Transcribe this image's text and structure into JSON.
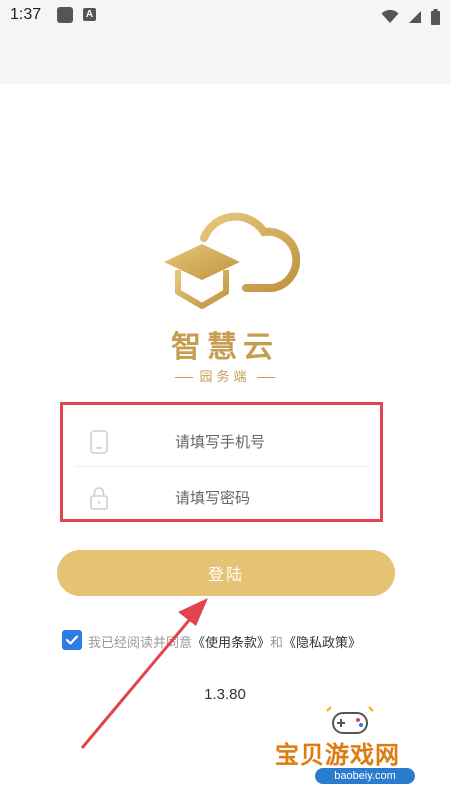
{
  "status_bar": {
    "time": "1:37",
    "app_badge": "A"
  },
  "brand": {
    "name": "智慧云",
    "subtitle": "园务端"
  },
  "form": {
    "phone_placeholder": "请填写手机号",
    "password_placeholder": "请填写密码"
  },
  "login_button": {
    "label": "登陆"
  },
  "agreement": {
    "prefix": "我已经阅读并同意",
    "terms": "《使用条款》",
    "conjunction": "和",
    "privacy": "《隐私政策》",
    "checked": true
  },
  "version": "1.3.80",
  "watermark": {
    "title": "宝贝游戏网",
    "url": "baobeiy.com"
  },
  "colors": {
    "brand_gold": "#c79e51",
    "button_gold": "#e6c374",
    "annotation_red": "#e2434e",
    "checkbox_blue": "#2f7ae5"
  }
}
